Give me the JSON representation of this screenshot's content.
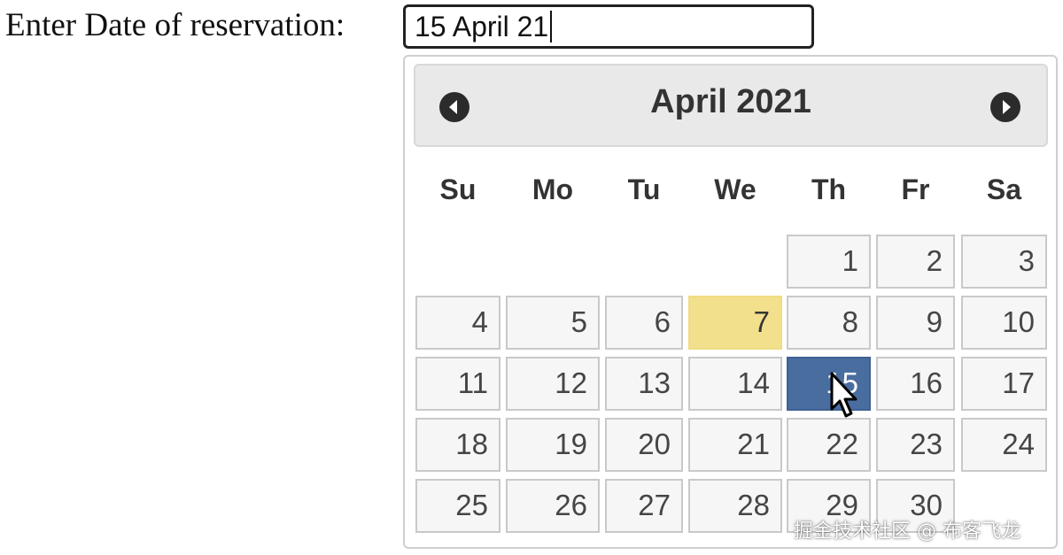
{
  "form": {
    "label": "Enter Date of reservation:",
    "input_value": "15 April 21"
  },
  "calendar": {
    "month_title": "April 2021",
    "prev_icon": "chevron-left-circle-icon",
    "next_icon": "chevron-right-circle-icon",
    "weekdays": [
      "Su",
      "Mo",
      "Tu",
      "We",
      "Th",
      "Fr",
      "Sa"
    ],
    "weeks": [
      [
        "",
        "",
        "",
        "",
        "1",
        "2",
        "3"
      ],
      [
        "4",
        "5",
        "6",
        "7",
        "8",
        "9",
        "10"
      ],
      [
        "11",
        "12",
        "13",
        "14",
        "15",
        "16",
        "17"
      ],
      [
        "18",
        "19",
        "20",
        "21",
        "22",
        "23",
        "24"
      ],
      [
        "25",
        "26",
        "27",
        "28",
        "29",
        "30",
        ""
      ]
    ],
    "today": "7",
    "selected": "15"
  },
  "colors": {
    "today_bg": "#f3e08c",
    "selected_bg": "#4a6da0",
    "header_bg": "#e9e9e9",
    "day_bg": "#f6f6f6"
  },
  "watermark": "掘金技术社区 @ 布客飞龙"
}
